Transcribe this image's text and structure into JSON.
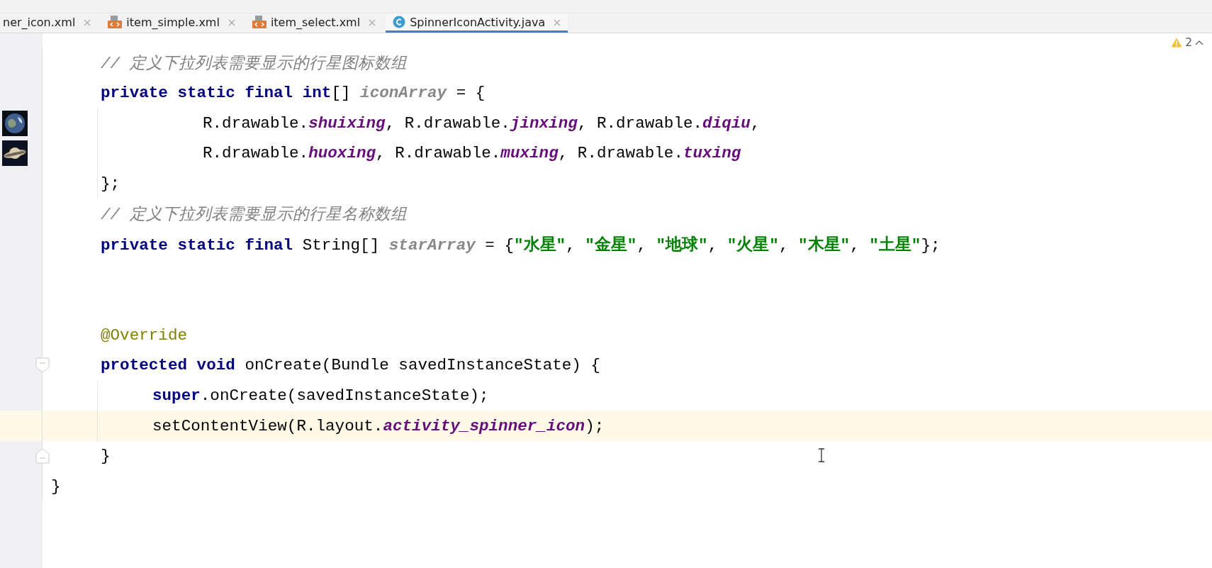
{
  "tabs": [
    {
      "label": "ner_icon.xml",
      "kind": "plain",
      "selected": false
    },
    {
      "label": "item_simple.xml",
      "kind": "xml",
      "selected": false
    },
    {
      "label": "item_select.xml",
      "kind": "xml",
      "selected": false
    },
    {
      "label": "SpinnerIconActivity.java",
      "kind": "java",
      "selected": true
    }
  ],
  "inspection": {
    "warnings": "2"
  },
  "code_lines": [
    {
      "kind": "member",
      "current": false,
      "tokens": [
        {
          "t": "// 定义下拉列表需要显示的行星图标数组",
          "kind": "comment"
        }
      ]
    },
    {
      "kind": "member",
      "current": false,
      "tokens": [
        {
          "t": "private static final int",
          "kind": "keyword"
        },
        {
          "t": "[] ",
          "kind": "plain"
        },
        {
          "t": "iconArray",
          "kind": "static"
        },
        {
          "t": " = {",
          "kind": "plain"
        }
      ]
    },
    {
      "kind": "cont",
      "current": false,
      "gutter": {
        "kind": "earth"
      },
      "tokens": [
        {
          "t": "R.drawable.",
          "kind": "plain"
        },
        {
          "t": "shuixing",
          "kind": "field"
        },
        {
          "t": ", R.drawable.",
          "kind": "plain"
        },
        {
          "t": "jinxing",
          "kind": "field"
        },
        {
          "t": ", R.drawable.",
          "kind": "plain"
        },
        {
          "t": "diqiu",
          "kind": "field"
        },
        {
          "t": ",",
          "kind": "plain"
        }
      ]
    },
    {
      "kind": "cont",
      "current": false,
      "gutter": {
        "kind": "saturn"
      },
      "tokens": [
        {
          "t": "R.drawable.",
          "kind": "plain"
        },
        {
          "t": "huoxing",
          "kind": "field"
        },
        {
          "t": ", R.drawable.",
          "kind": "plain"
        },
        {
          "t": "muxing",
          "kind": "field"
        },
        {
          "t": ", R.drawable.",
          "kind": "plain"
        },
        {
          "t": "tuxing",
          "kind": "field"
        }
      ]
    },
    {
      "kind": "member",
      "current": false,
      "tokens": [
        {
          "t": "};",
          "kind": "plain"
        }
      ]
    },
    {
      "kind": "member",
      "current": false,
      "tokens": [
        {
          "t": "// 定义下拉列表需要显示的行星名称数组",
          "kind": "comment"
        }
      ]
    },
    {
      "kind": "member",
      "current": false,
      "tokens": [
        {
          "t": "private static final",
          "kind": "keyword"
        },
        {
          "t": " String[] ",
          "kind": "plain"
        },
        {
          "t": "starArray",
          "kind": "static"
        },
        {
          "t": " = {",
          "kind": "plain"
        },
        {
          "t": "\"水星\"",
          "kind": "string"
        },
        {
          "t": ", ",
          "kind": "plain"
        },
        {
          "t": "\"金星\"",
          "kind": "string"
        },
        {
          "t": ", ",
          "kind": "plain"
        },
        {
          "t": "\"地球\"",
          "kind": "string"
        },
        {
          "t": ", ",
          "kind": "plain"
        },
        {
          "t": "\"火星\"",
          "kind": "string"
        },
        {
          "t": ", ",
          "kind": "plain"
        },
        {
          "t": "\"木星\"",
          "kind": "string"
        },
        {
          "t": ", ",
          "kind": "plain"
        },
        {
          "t": "\"土星\"",
          "kind": "string"
        },
        {
          "t": "};",
          "kind": "plain"
        }
      ]
    },
    {
      "kind": "blank",
      "current": false
    },
    {
      "kind": "blank",
      "current": false
    },
    {
      "kind": "member",
      "current": false,
      "tokens": [
        {
          "t": "@Override",
          "kind": "annotation"
        }
      ]
    },
    {
      "kind": "member",
      "current": false,
      "gutter": {
        "kind": "fold-start"
      },
      "tokens": [
        {
          "t": "protected void",
          "kind": "keyword"
        },
        {
          "t": " onCreate(Bundle savedInstanceState) {",
          "kind": "plain"
        }
      ]
    },
    {
      "kind": "body",
      "current": false,
      "tokens": [
        {
          "t": "super",
          "kind": "keyword"
        },
        {
          "t": ".onCreate(savedInstanceState);",
          "kind": "plain"
        }
      ]
    },
    {
      "kind": "body",
      "current": true,
      "tokens": [
        {
          "t": "setContentView(R.layout.",
          "kind": "plain"
        },
        {
          "t": "activity_spinner_icon",
          "kind": "field"
        },
        {
          "t": ");",
          "kind": "plain"
        }
      ]
    },
    {
      "kind": "member",
      "current": false,
      "gutter": {
        "kind": "fold-end"
      },
      "tokens": [
        {
          "t": "}",
          "kind": "plain"
        }
      ]
    },
    {
      "kind": "class",
      "current": false,
      "tokens": [
        {
          "t": "}",
          "kind": "plain"
        }
      ]
    }
  ]
}
